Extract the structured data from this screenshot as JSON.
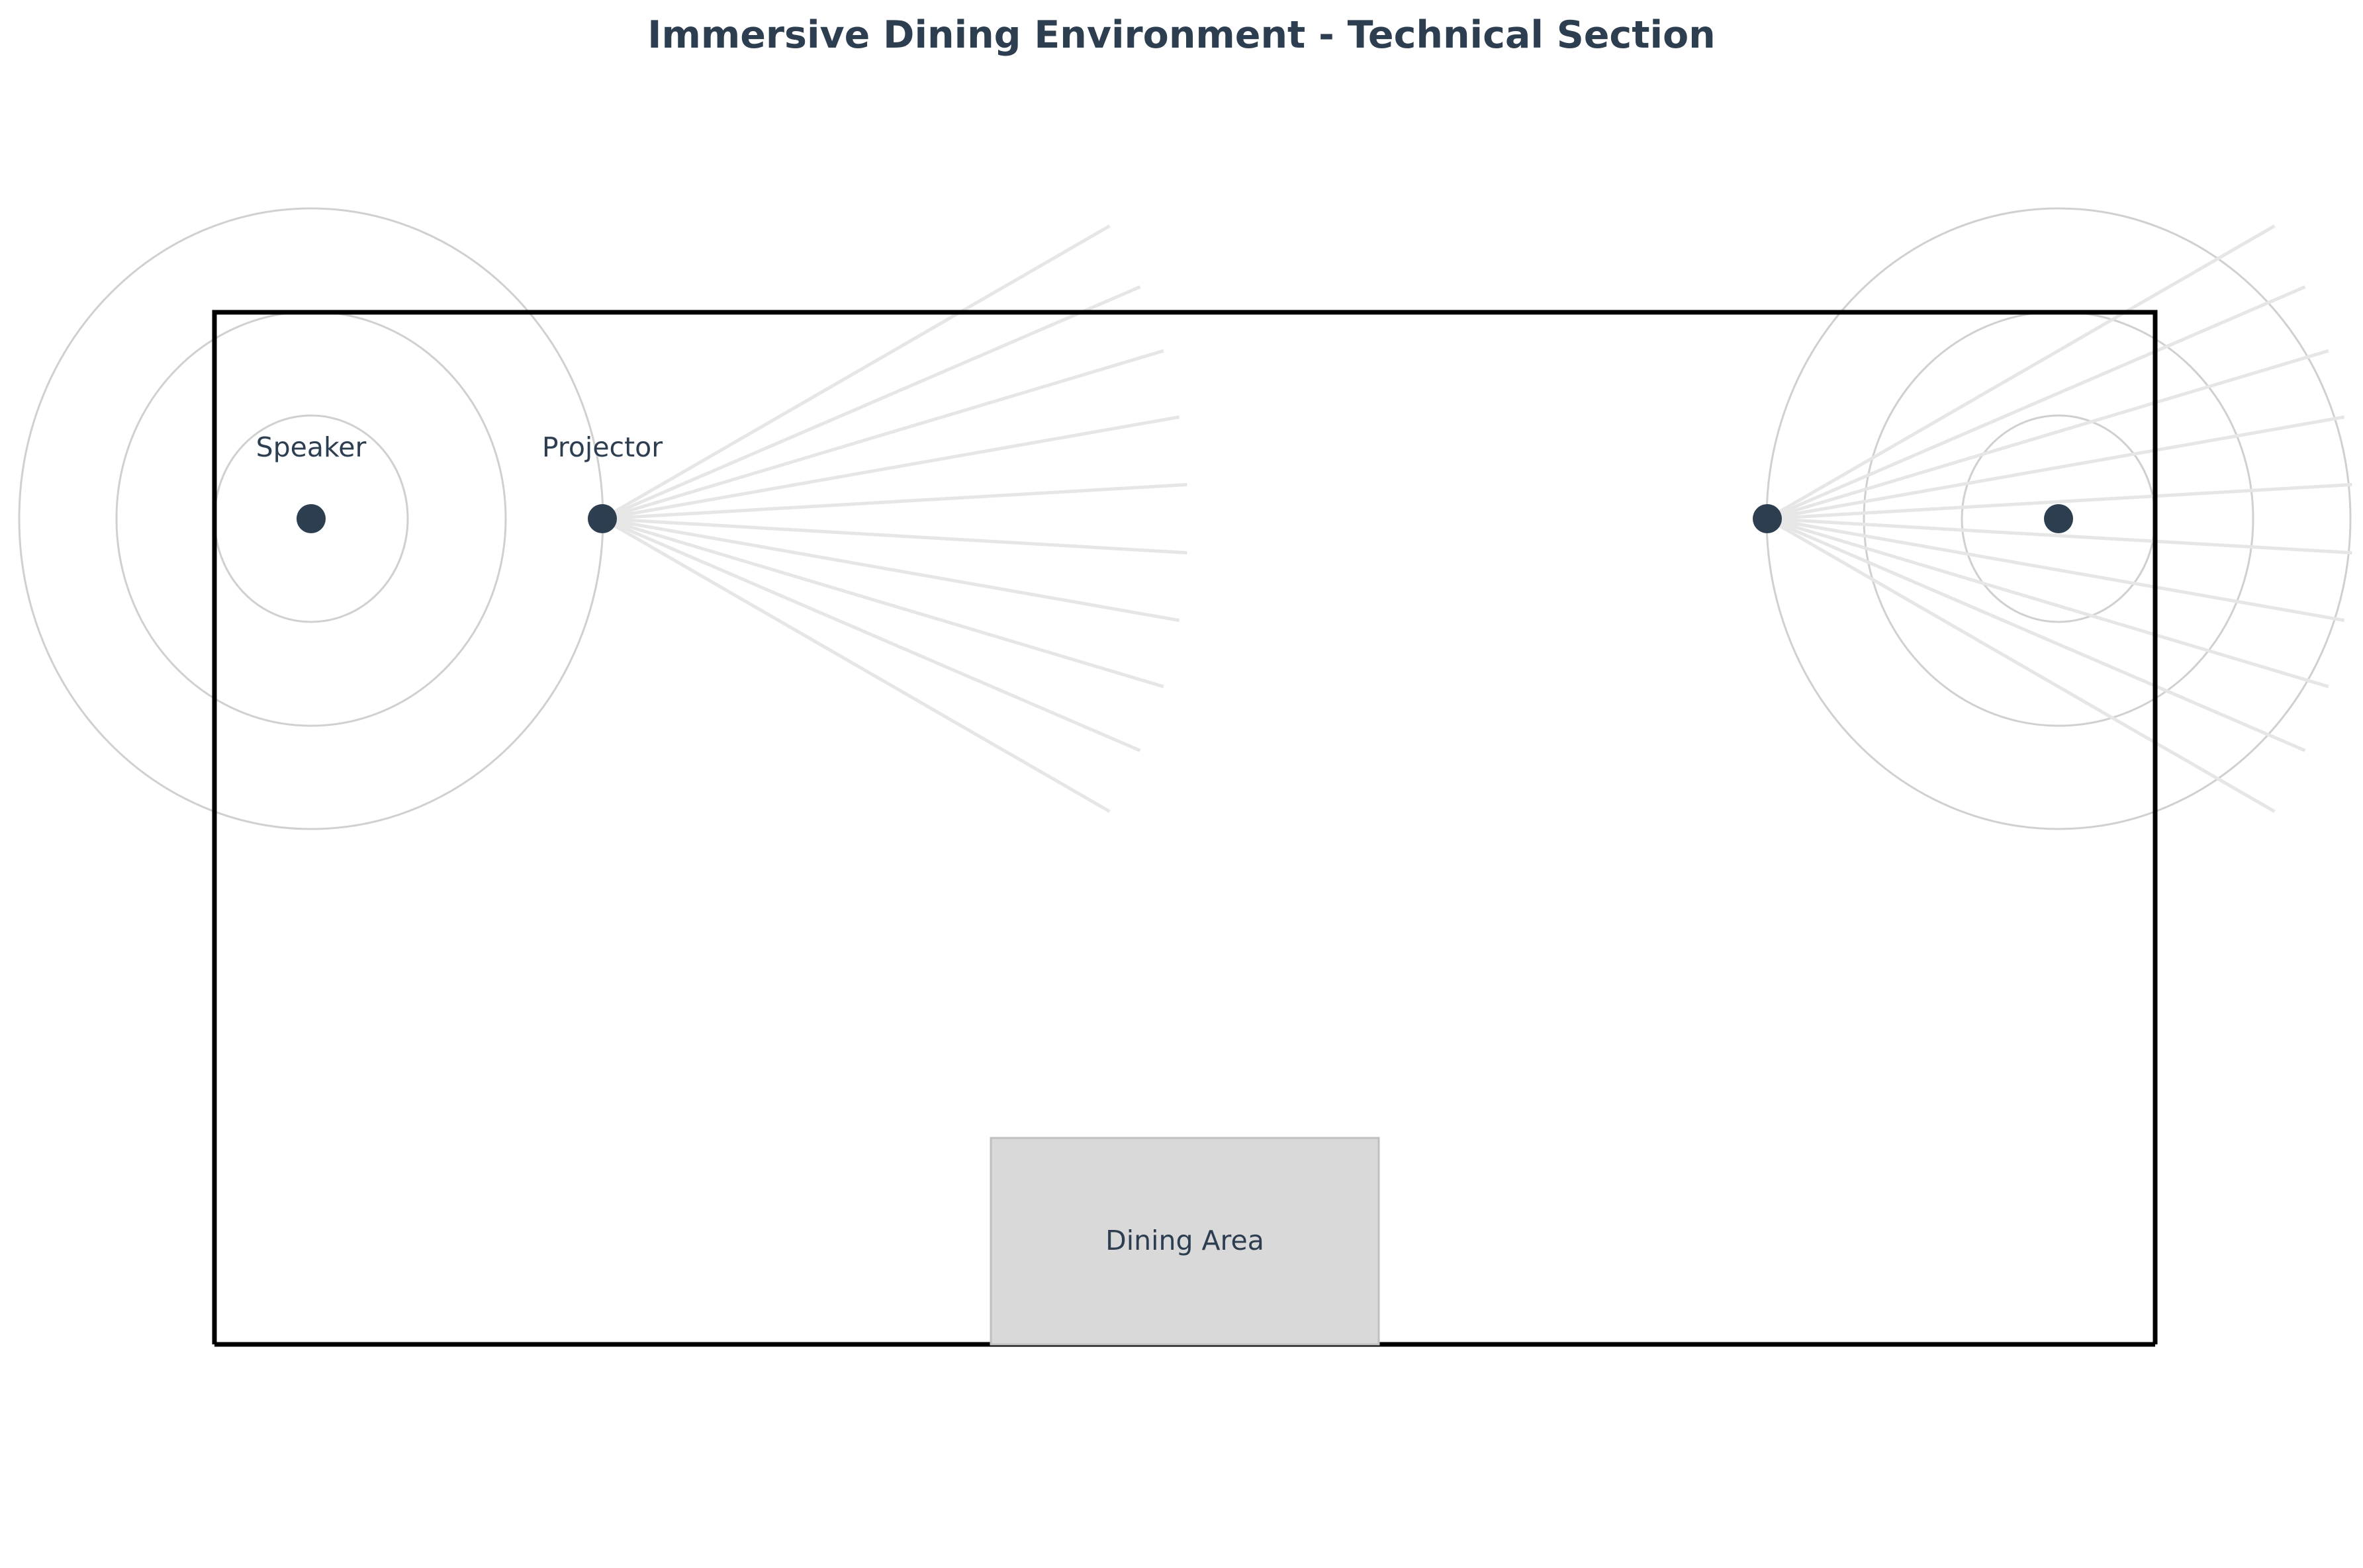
{
  "title": "Immersive Dining Environment - Technical Section",
  "labels": {
    "speaker": "Speaker",
    "projector": "Projector",
    "dining_area": "Dining Area"
  },
  "colors": {
    "text": "#2d3e50",
    "device": "#2d3e50",
    "room_outline": "#000000",
    "wave_ring": "#d0d0d0",
    "beam": "#e6e6e6",
    "dining_fill": "#d9d9d9",
    "dining_border": "#c0c0c0"
  }
}
